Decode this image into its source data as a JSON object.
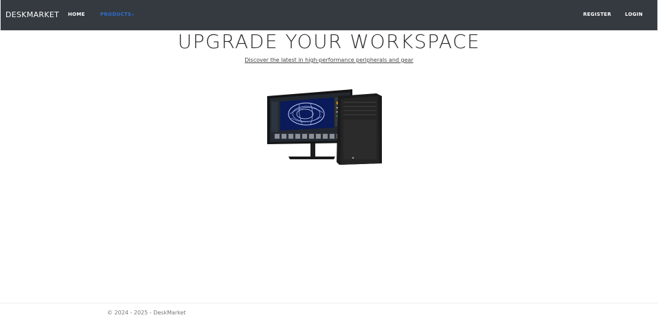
{
  "nav": {
    "brand": "DESKMARKET",
    "home": "HOME",
    "products": "PRODUCTS",
    "products_caret": "▾",
    "register": "REGISTER",
    "login": "LOGIN",
    "active_color": "#2f6ed1",
    "bg_color": "#343a40"
  },
  "hero": {
    "title": "UPGRADE YOUR WORKSPACE",
    "subtitle": "Discover the latest in high-performance peripherals and gear",
    "image_icon": "workstation-monitor-tower-image"
  },
  "footer": {
    "text": "© 2024 - 2025 - DeskMarket"
  }
}
